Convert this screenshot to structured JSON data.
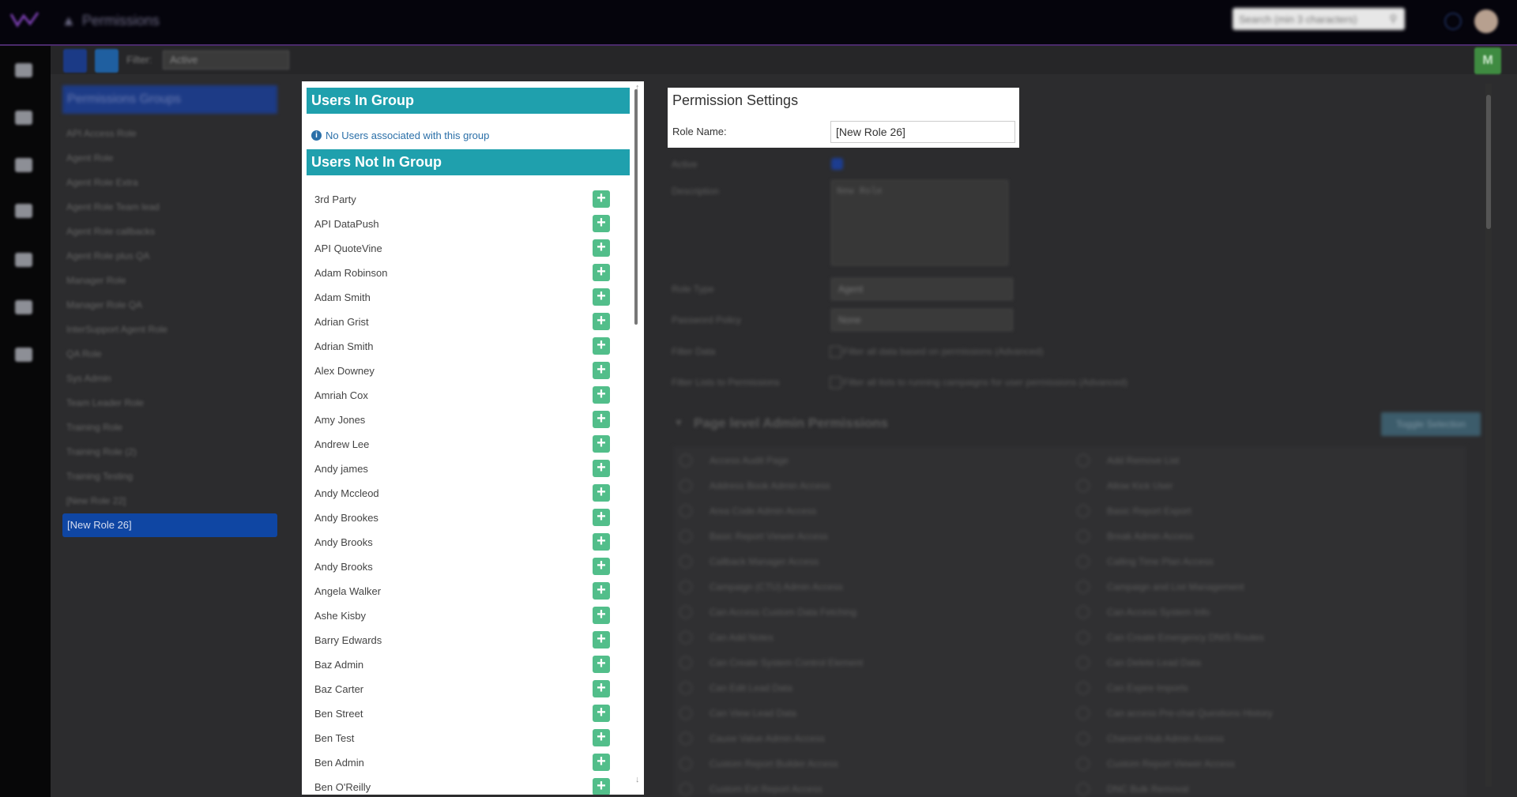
{
  "app": {
    "title": "Permissions",
    "search_placeholder": "Search (min 3 characters)"
  },
  "toolbar": {
    "filter_label": "Filter:",
    "filter_value": "Active",
    "m_label": "M"
  },
  "groups": {
    "header": "Permissions Groups",
    "items": [
      "API Access Role",
      "Agent Role",
      "Agent Role Extra",
      "Agent Role Team lead",
      "Agent Role callbacks",
      "Agent Role plus QA",
      "Manager Role",
      "Manager Role QA",
      "InterSupport Agent Role",
      "QA Role",
      "Sys Admin",
      "Team Leader Role",
      "Training Role",
      "Training Role (2)",
      "Training Testing",
      "[New Role 22]",
      "[New Role 26]"
    ],
    "selected": "[New Role 26]"
  },
  "users_panel": {
    "in_group_header": "Users In Group",
    "no_users_text": "No Users associated with this group",
    "not_in_group_header": "Users Not In Group",
    "users": [
      "3rd Party",
      "API DataPush",
      "API QuoteVine",
      "Adam Robinson",
      "Adam Smith",
      "Adrian Grist",
      "Adrian Smith",
      "Alex Downey",
      "Amriah Cox",
      "Amy Jones",
      "Andrew Lee",
      "Andy james",
      "Andy Mccleod",
      "Andy Brookes",
      "Andy Brooks",
      "Andy Brooks",
      "Angela Walker",
      "Ashe Kisby",
      "Barry Edwards",
      "Baz Admin",
      "Baz Carter",
      "Ben Street",
      "Ben Test",
      "Ben Admin",
      "Ben O'Reilly"
    ]
  },
  "permission_settings": {
    "title": "Permission Settings",
    "role_name_label": "Role Name:",
    "role_name_value": "[New Role 26]",
    "active_label": "Active",
    "description_label": "Description",
    "description_value": "New Role",
    "role_type_label": "Role Type",
    "role_type_value": "Agent",
    "password_policy_label": "Password Policy",
    "password_policy_value": "None",
    "filter_data_label": "Filter Data",
    "filter_data_text": "Filter all data based on permissions (Advanced)",
    "filter_lists_label": "Filter Lists to Permissions",
    "filter_lists_text": "Filter all lists to running campaigns for user permissions (Advanced)",
    "page_admin_title": "Page level Admin Permissions",
    "toggle_button": "Toggle Selection",
    "left_perms": [
      "Access Audit Page",
      "Address Book Admin Access",
      "Area Code Admin Access",
      "Basic Report Viewer Access",
      "Callback Manager Access",
      "Campaign (CTU) Admin Access",
      "Can Access Custom Data Fetching",
      "Can Add Notes",
      "Can Create System Control Element",
      "Can Edit Lead Data",
      "Can View Lead Data",
      "Cause Value Admin Access",
      "Custom Report Builder Access",
      "Custom Ext Report Access"
    ],
    "right_perms": [
      "Add Remove List",
      "Allow Kick User",
      "Basic Report Export",
      "Break Admin Access",
      "Calling Time Plan Access",
      "Campaign and List Management",
      "Can Access System Info",
      "Can Create Emergency DNIS Routes",
      "Can Delete Lead Data",
      "Can Expire Imports",
      "Can access Pre-chat Questions History",
      "Channel Hub Admin Access",
      "Custom Report Viewer Access",
      "DNC Bulk Removal"
    ]
  },
  "colors": {
    "teal_header": "#1fa0ad",
    "add_green": "#52be8a",
    "selected_blue": "#0f46a3",
    "link_blue": "#2a6fa8"
  }
}
